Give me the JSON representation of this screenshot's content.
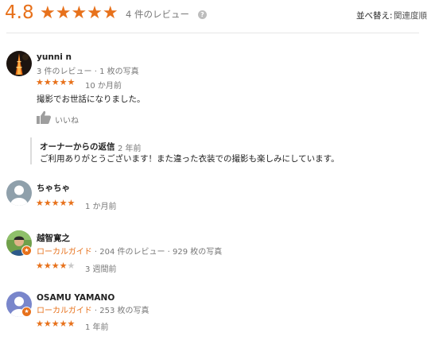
{
  "summary": {
    "rating": "4.8",
    "stars": "★★★★★",
    "review_count": "4 件のレビュー",
    "help_icon": "?",
    "sort_label": "並べ替え:",
    "sort_value": "関連度順"
  },
  "reviews": [
    {
      "name": "yunni n",
      "meta": "3 件のレビュー · 1 枚の写真",
      "stars_on": "★★★★★",
      "stars_off": "",
      "rating": 5,
      "time": "10 か月前",
      "text": "撮影でお世話になりました。",
      "like_label": "いいね",
      "reply": {
        "owner_label": "オーナーからの返信",
        "time": "2 年前",
        "text": "ご利用ありがとうございます！また違った衣装での撮影も楽しみにしています。"
      }
    },
    {
      "name": "ちゃちゃ",
      "stars_on": "★★★★★",
      "stars_off": "",
      "rating": 5,
      "time": "1 か月前"
    },
    {
      "name": "越智寛之",
      "guide": "ローカルガイド",
      "meta": " · 204 件のレビュー · 929 枚の写真",
      "stars_on": "★★★★",
      "stars_off": "★",
      "rating": 4,
      "time": "3 週間前"
    },
    {
      "name": "OSAMU YAMANO",
      "guide": "ローカルガイド",
      "meta": " · 253 枚の写真",
      "stars_on": "★★★★★",
      "stars_off": "",
      "rating": 5,
      "time": "1 年前"
    }
  ],
  "colors": {
    "accent": "#e7711b",
    "star_off": "#c8c8c8",
    "muted": "#777777"
  },
  "icons": [
    "help-icon",
    "thumbs-up-icon",
    "local-guide-badge-icon",
    "default-avatar-icon"
  ]
}
